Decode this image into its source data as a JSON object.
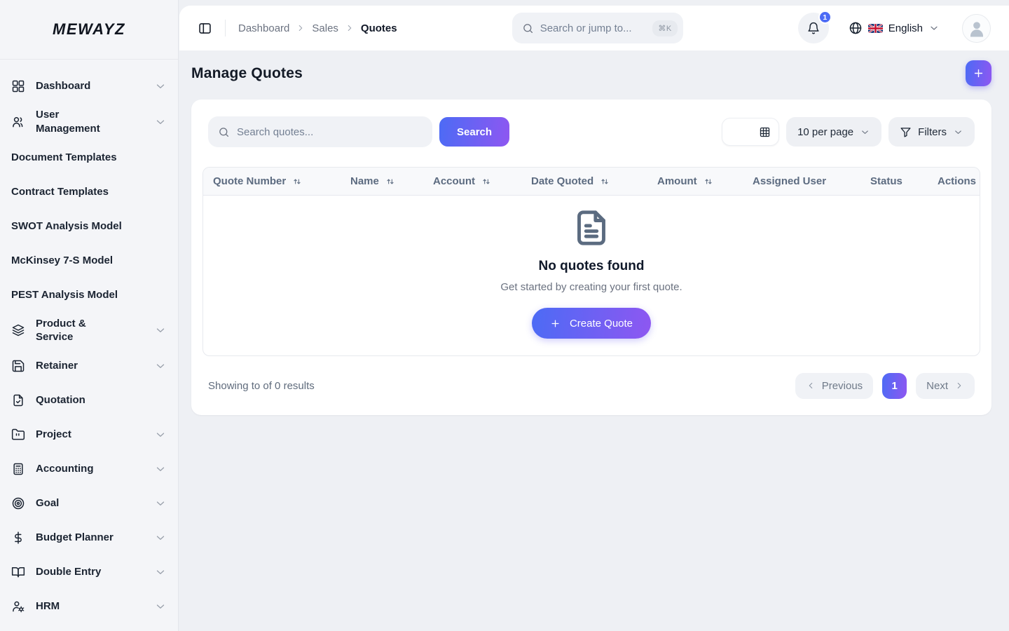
{
  "brand": {
    "logo_text": "MEWAYZ"
  },
  "sidebar": {
    "items": [
      {
        "label": "Dashboard",
        "icon": "dashboard-grid-icon",
        "has_chevron": true
      },
      {
        "label": "User Management",
        "icon": "users-icon",
        "has_chevron": true
      },
      {
        "label": "Document Templates",
        "icon": null,
        "has_chevron": false
      },
      {
        "label": "Contract Templates",
        "icon": null,
        "has_chevron": false
      },
      {
        "label": "SWOT Analysis Model",
        "icon": null,
        "has_chevron": false
      },
      {
        "label": "McKinsey 7-S Model",
        "icon": null,
        "has_chevron": false
      },
      {
        "label": "PEST Analysis Model",
        "icon": null,
        "has_chevron": false
      },
      {
        "label": "Product & Service",
        "icon": "layers-icon",
        "has_chevron": true
      },
      {
        "label": "Retainer",
        "icon": "save-icon",
        "has_chevron": true
      },
      {
        "label": "Quotation",
        "icon": "file-check-icon",
        "has_chevron": false
      },
      {
        "label": "Project",
        "icon": "folder-icon",
        "has_chevron": true
      },
      {
        "label": "Accounting",
        "icon": "calculator-icon",
        "has_chevron": true
      },
      {
        "label": "Goal",
        "icon": "target-icon",
        "has_chevron": true
      },
      {
        "label": "Budget Planner",
        "icon": "dollar-icon",
        "has_chevron": true
      },
      {
        "label": "Double Entry",
        "icon": "book-open-icon",
        "has_chevron": true
      },
      {
        "label": "HRM",
        "icon": "user-gear-icon",
        "has_chevron": true
      }
    ]
  },
  "header": {
    "breadcrumb": {
      "items": [
        "Dashboard",
        "Sales",
        "Quotes"
      ]
    },
    "search": {
      "placeholder": "Search or jump to...",
      "shortcut": "⌘K"
    },
    "notifications": {
      "count": "1"
    },
    "language": {
      "label": "English"
    }
  },
  "page": {
    "title": "Manage Quotes"
  },
  "toolbar": {
    "search_placeholder": "Search quotes...",
    "search_button_label": "Search",
    "per_page_label": "10 per page",
    "filters_label": "Filters"
  },
  "table": {
    "columns": [
      {
        "label": "Quote Number",
        "sortable": true
      },
      {
        "label": "Name",
        "sortable": true
      },
      {
        "label": "Account",
        "sortable": true
      },
      {
        "label": "Date Quoted",
        "sortable": true
      },
      {
        "label": "Amount",
        "sortable": true
      },
      {
        "label": "Assigned User",
        "sortable": false
      },
      {
        "label": "Status",
        "sortable": false
      },
      {
        "label": "Actions",
        "sortable": false
      }
    ]
  },
  "empty_state": {
    "title": "No quotes found",
    "subtitle": "Get started by creating your first quote.",
    "cta_label": "Create Quote"
  },
  "pagination": {
    "summary": "Showing to of 0 results",
    "previous_label": "Previous",
    "current_page": "1",
    "next_label": "Next"
  },
  "colors": {
    "accent_gradient_start": "#4c6bf5",
    "accent_gradient_end": "#8e57f1",
    "badge_blue": "#4c6bf5"
  }
}
